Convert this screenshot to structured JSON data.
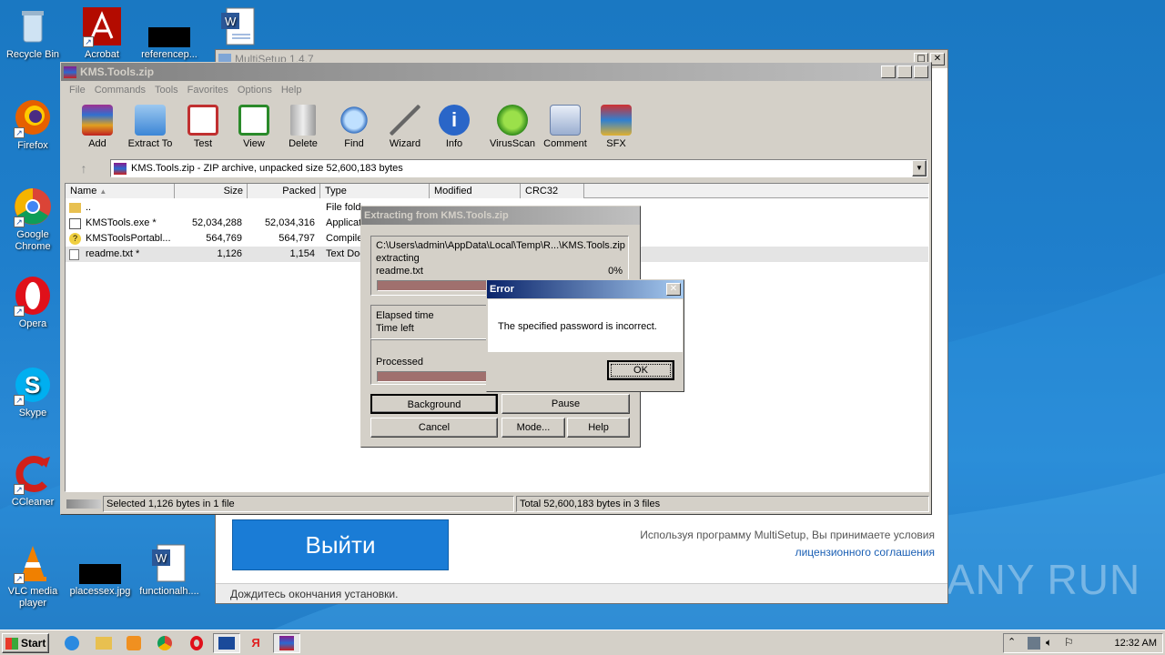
{
  "desktop": {
    "icons": [
      {
        "label": "Recycle Bin",
        "icon": "recycle-bin-icon"
      },
      {
        "label": "Acrobat",
        "icon": "acrobat-icon"
      },
      {
        "label": "referencep...",
        "icon": "image-file-icon"
      },
      {
        "label": "Firefox",
        "icon": "firefox-icon"
      },
      {
        "label": "Google Chrome",
        "icon": "chrome-icon"
      },
      {
        "label": "Opera",
        "icon": "opera-icon"
      },
      {
        "label": "Skype",
        "icon": "skype-icon"
      },
      {
        "label": "CCleaner",
        "icon": "ccleaner-icon"
      },
      {
        "label": "VLC media player",
        "icon": "vlc-icon"
      },
      {
        "label": "placessex.jpg",
        "icon": "image-file-icon"
      },
      {
        "label": "functionalh....",
        "icon": "word-doc-icon"
      }
    ],
    "watermark": "ANY RUN"
  },
  "multisetup": {
    "title": "MultiSetup 1.4.7",
    "exit_button": "Выйти",
    "license_text": "Используя программу MultiSetup, Вы принимаете условия",
    "license_link": "лицензионного соглашения",
    "status": "Дождитесь окончания установки."
  },
  "winrar": {
    "title": "KMS.Tools.zip",
    "menu": [
      "File",
      "Commands",
      "Tools",
      "Favorites",
      "Options",
      "Help"
    ],
    "toolbar": [
      "Add",
      "Extract To",
      "Test",
      "View",
      "Delete",
      "Find",
      "Wizard",
      "Info",
      "VirusScan",
      "Comment",
      "SFX"
    ],
    "path": "KMS.Tools.zip - ZIP archive, unpacked size 52,600,183 bytes",
    "columns": [
      "Name",
      "Size",
      "Packed",
      "Type",
      "Modified",
      "CRC32"
    ],
    "files": [
      {
        "name": "..",
        "size": "",
        "packed": "",
        "type": "File folder"
      },
      {
        "name": "KMSTools.exe *",
        "size": "52,034,288",
        "packed": "52,034,316",
        "type": "Application"
      },
      {
        "name": "KMSToolsPortabl...",
        "size": "564,769",
        "packed": "564,797",
        "type": "Compiled"
      },
      {
        "name": "readme.txt *",
        "size": "1,126",
        "packed": "1,154",
        "type": "Text Doc"
      }
    ],
    "status_left": "Selected 1,126 bytes in 1 file",
    "status_right": "Total 52,600,183 bytes in 3 files"
  },
  "extract_dialog": {
    "title": "Extracting from KMS.Tools.zip",
    "path": "C:\\Users\\admin\\AppData\\Local\\Temp\\R...\\KMS.Tools.zip",
    "action": "extracting",
    "file": "readme.txt",
    "percent": "0%",
    "elapsed_label": "Elapsed time",
    "timeleft_label": "Time left",
    "processed_label": "Processed",
    "buttons": {
      "background": "Background",
      "pause": "Pause",
      "cancel": "Cancel",
      "mode": "Mode...",
      "help": "Help"
    }
  },
  "error_dialog": {
    "title": "Error",
    "message": "The specified password is incorrect.",
    "ok": "OK"
  },
  "taskbar": {
    "start": "Start",
    "clock": "12:32 AM"
  },
  "colors": {
    "titlebar_active": "#0a246a",
    "titlebar_active_end": "#a6caf0",
    "titlebar_inactive": "#808080",
    "multisetup_blue": "#1a7cd6",
    "progress": "#a0706e"
  }
}
